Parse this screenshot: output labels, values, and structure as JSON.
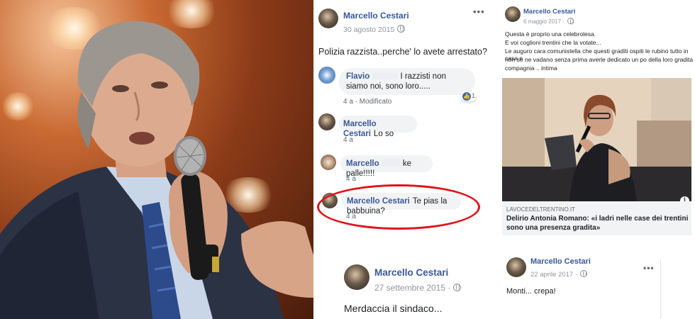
{
  "post_left_top": {
    "author": "Marcello Cestari",
    "date": "30 agosto 2015",
    "more": "•••",
    "text": "Polizia razzista..perche' lo avete arrestato?",
    "comments": [
      {
        "author": "Flavio",
        "text": "I razzisti non siamo noi, sono loro.....",
        "time": "4 a",
        "extra": "Modificato",
        "likes": "1",
        "like_icon": "thumbs-up-icon"
      },
      {
        "author": "Marcello Cestari",
        "text": "Lo so",
        "time": "4 a"
      },
      {
        "author": "Marcello",
        "text": "ke palle!!!!!",
        "time": "4 a"
      },
      {
        "author": "Marcello Cestari",
        "text": "Te pias la babbuina?",
        "time": "4 a"
      }
    ]
  },
  "post_left_bottom": {
    "author": "Marcello Cestari",
    "date": "27 settembre 2015",
    "separator": "·",
    "text": "Merdaccia il sindaco..."
  },
  "post_right_top": {
    "author": "Marcello Cestari",
    "date": "6 maggio 2017",
    "separator": "·",
    "lines": [
      "Questa è proprio una celebrolesa.",
      "E voi coglioni trentini che la votate...",
      "Le auguro cara comunistella che questi graditi ospiti le rubino tutto in casa e",
      "non se ne vadano senza prima averle dedicato un po della loro gradita",
      "compagnia .. intima"
    ],
    "link": {
      "source": "LAVOCEDELTRENTINO.IT",
      "title": "Delirio Antonia Romano: «i ladri nelle case dei trentini sono una presenza gradita»",
      "info": "i"
    }
  },
  "post_right_bottom": {
    "author": "Marcello Cestari",
    "date": "22 aprile 2017",
    "separator": "·",
    "more": "•••",
    "text": "Monti... crepa!"
  },
  "colors": {
    "link_blue": "#385898",
    "highlight_red": "#e0141e",
    "bubble_gray": "#f2f3f5",
    "meta_gray": "#90949c",
    "like_blue": "#4267b2"
  }
}
